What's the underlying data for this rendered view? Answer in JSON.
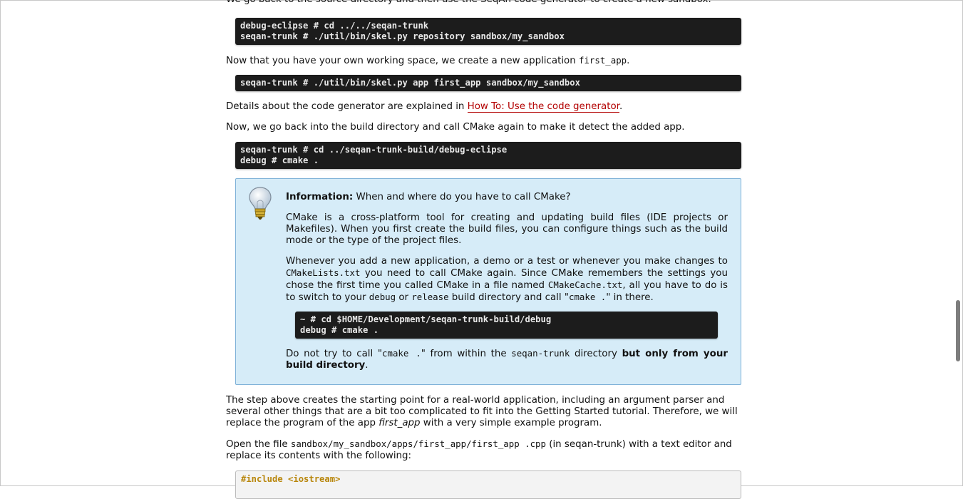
{
  "para_intro": "We go back to the source directory and then use the SeqAn code generator to create a new sandbox.",
  "code1": [
    "debug-eclipse # cd ../../seqan-trunk",
    "seqan-trunk # ./util/bin/skel.py repository sandbox/my_sandbox"
  ],
  "para_new_app": {
    "text": "Now that you have your own working space, we create a new application ",
    "code": "first_app",
    "end": "."
  },
  "code2": [
    "seqan-trunk # ./util/bin/skel.py app first_app sandbox/my_sandbox"
  ],
  "para_details": {
    "text": "Details about the code generator are explained in ",
    "link": "How To: Use the code generator",
    "end": "."
  },
  "para_cmake": "Now, we go back into the build directory and call CMake again to make it detect the added app.",
  "code3": [
    "seqan-trunk # cd ../seqan-trunk-build/debug-eclipse",
    "debug # cmake ."
  ],
  "info": {
    "icon": "lightbulb-icon",
    "title": "Information:",
    "question": " When and where do you have to call CMake?",
    "p1": "CMake is a cross-platform tool for creating and updating build files (IDE projects or Makefiles). When you first create the build files, you can configure things such as the build mode or the type of the project files.",
    "p2_a": "Whenever you add a new application, a demo or a test or whenever you make changes to ",
    "p2_code1": "CMakeLists.txt",
    "p2_b": " you need to call CMake again. Since CMake remembers the settings you chose the first time you called CMake in a file named ",
    "p2_code2": "CMakeCache.txt",
    "p2_c": ", all you have to do is to switch to your ",
    "p2_code3": "debug",
    "p2_d": " or ",
    "p2_code4": "release",
    "p2_e": " build directory and call \"",
    "p2_code5": "cmake .",
    "p2_f": "\" in there.",
    "code": [
      "~ # cd $HOME/Development/seqan-trunk-build/debug",
      "debug # cmake ."
    ],
    "p3_a": "Do not try to call \"",
    "p3_code1": "cmake .",
    "p3_b": "\" from within the ",
    "p3_code2": "seqan-trunk",
    "p3_c": " directory ",
    "p3_bold": "but only from your build directory",
    "p3_end": "."
  },
  "para_step": {
    "a": "The step above creates the starting point for a real-world application, including an argument parser and several other things that are a bit too complicated to fit into the Getting Started tutorial. Therefore, we will replace the program of the app ",
    "em": "first_app",
    "b": " with a very simple example program."
  },
  "para_open": {
    "a": "Open the file ",
    "code": "sandbox/my_sandbox/apps/first_app/first_app .cpp",
    "b": " (in seqan-trunk) with a text editor and replace its contents with the following:"
  },
  "code4_line1": "#include <iostream>",
  "colors": {
    "link": "#b30000",
    "code_bg": "#1c1c1c",
    "info_bg": "#d6ecf8",
    "info_border": "#7fb2d8",
    "include_orange": "#b8860b"
  }
}
